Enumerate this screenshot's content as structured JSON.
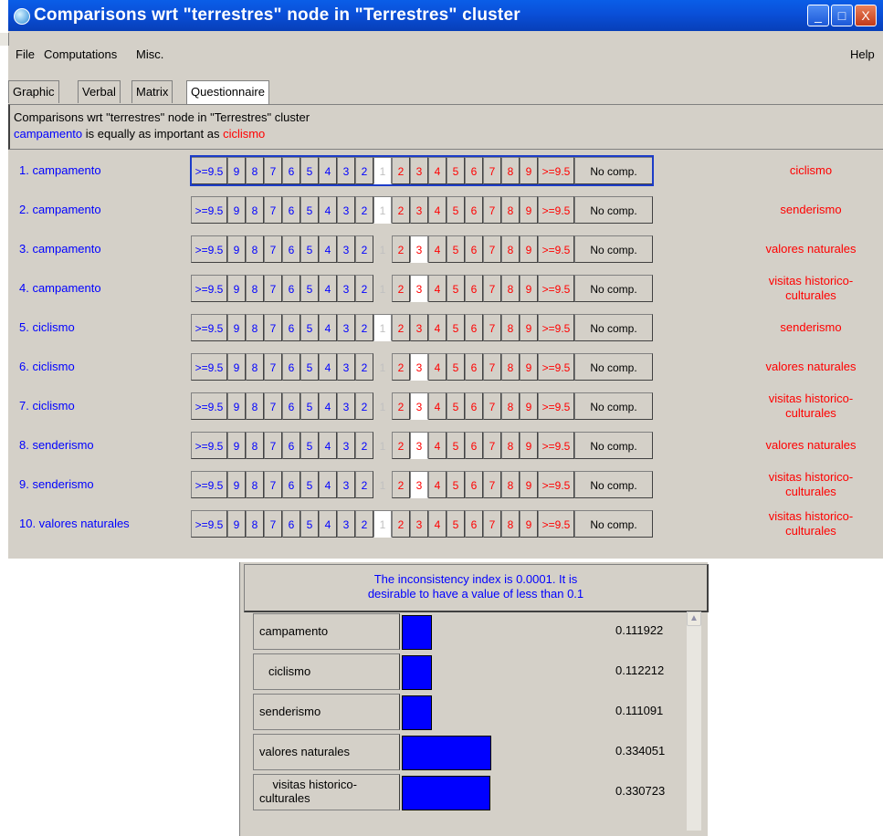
{
  "window": {
    "title": "Comparisons wrt \"terrestres\" node in \"Terrestres\" cluster",
    "buttons": {
      "minimize": "_",
      "maximize": "□",
      "close": "X"
    }
  },
  "menubar": {
    "file": "File",
    "computations": "Computations",
    "misc": "Misc.",
    "help": "Help"
  },
  "tabs": [
    "Graphic",
    "Verbal",
    "Matrix",
    "Questionnaire"
  ],
  "active_tab": "Questionnaire",
  "info": {
    "line1": "Comparisons wrt \"terrestres\" node in \"Terrestres\" cluster",
    "line2_left": "campamento",
    "line2_mid": " is equally as important as ",
    "line2_right": "ciclismo"
  },
  "scale_left": [
    ">=9.5",
    "9",
    "8",
    "7",
    "6",
    "5",
    "4",
    "3",
    "2"
  ],
  "scale_center": "1",
  "scale_right": [
    "2",
    "3",
    "4",
    "5",
    "6",
    "7",
    "8",
    "9",
    ">=9.5"
  ],
  "no_comp_label": "No comp.",
  "comparisons": [
    {
      "num": "1.",
      "left": "campamento",
      "right": "ciclismo",
      "selected": "1",
      "focused": true
    },
    {
      "num": "2.",
      "left": "campamento",
      "right": "senderismo",
      "selected": "1"
    },
    {
      "num": "3.",
      "left": "campamento",
      "right": "valores naturales",
      "selected": "3r"
    },
    {
      "num": "4.",
      "left": "campamento",
      "right": "visitas historico-culturales",
      "selected": "3r"
    },
    {
      "num": "5.",
      "left": "ciclismo",
      "right": "senderismo",
      "selected": "1"
    },
    {
      "num": "6.",
      "left": "ciclismo",
      "right": "valores naturales",
      "selected": "3r"
    },
    {
      "num": "7.",
      "left": "ciclismo",
      "right": "visitas historico-culturales",
      "selected": "3r"
    },
    {
      "num": "8.",
      "left": "senderismo",
      "right": "valores naturales",
      "selected": "3r"
    },
    {
      "num": "9.",
      "left": "senderismo",
      "right": "visitas historico-culturales",
      "selected": "3r"
    },
    {
      "num": "10.",
      "left": "valores naturales",
      "right": "visitas historico-culturales",
      "selected": "1"
    }
  ],
  "inconsistency": {
    "line1": "The inconsistency index is 0.0001.  It is",
    "line2": "desirable to have a value of less than 0.1"
  },
  "weights": [
    {
      "name": "campamento",
      "value": "0.111922",
      "w": 0.111922
    },
    {
      "name": "ciclismo",
      "value": "0.112212",
      "w": 0.112212
    },
    {
      "name": "senderismo",
      "value": "0.111091",
      "w": 0.111091
    },
    {
      "name": "valores naturales",
      "value": "0.334051",
      "w": 0.334051
    },
    {
      "name": "visitas historico-culturales",
      "value": "0.330723",
      "w": 0.330723
    }
  ],
  "colors": {
    "left_node": "#0000ff",
    "right_node": "#ff0000",
    "bar": "#0000ff"
  }
}
